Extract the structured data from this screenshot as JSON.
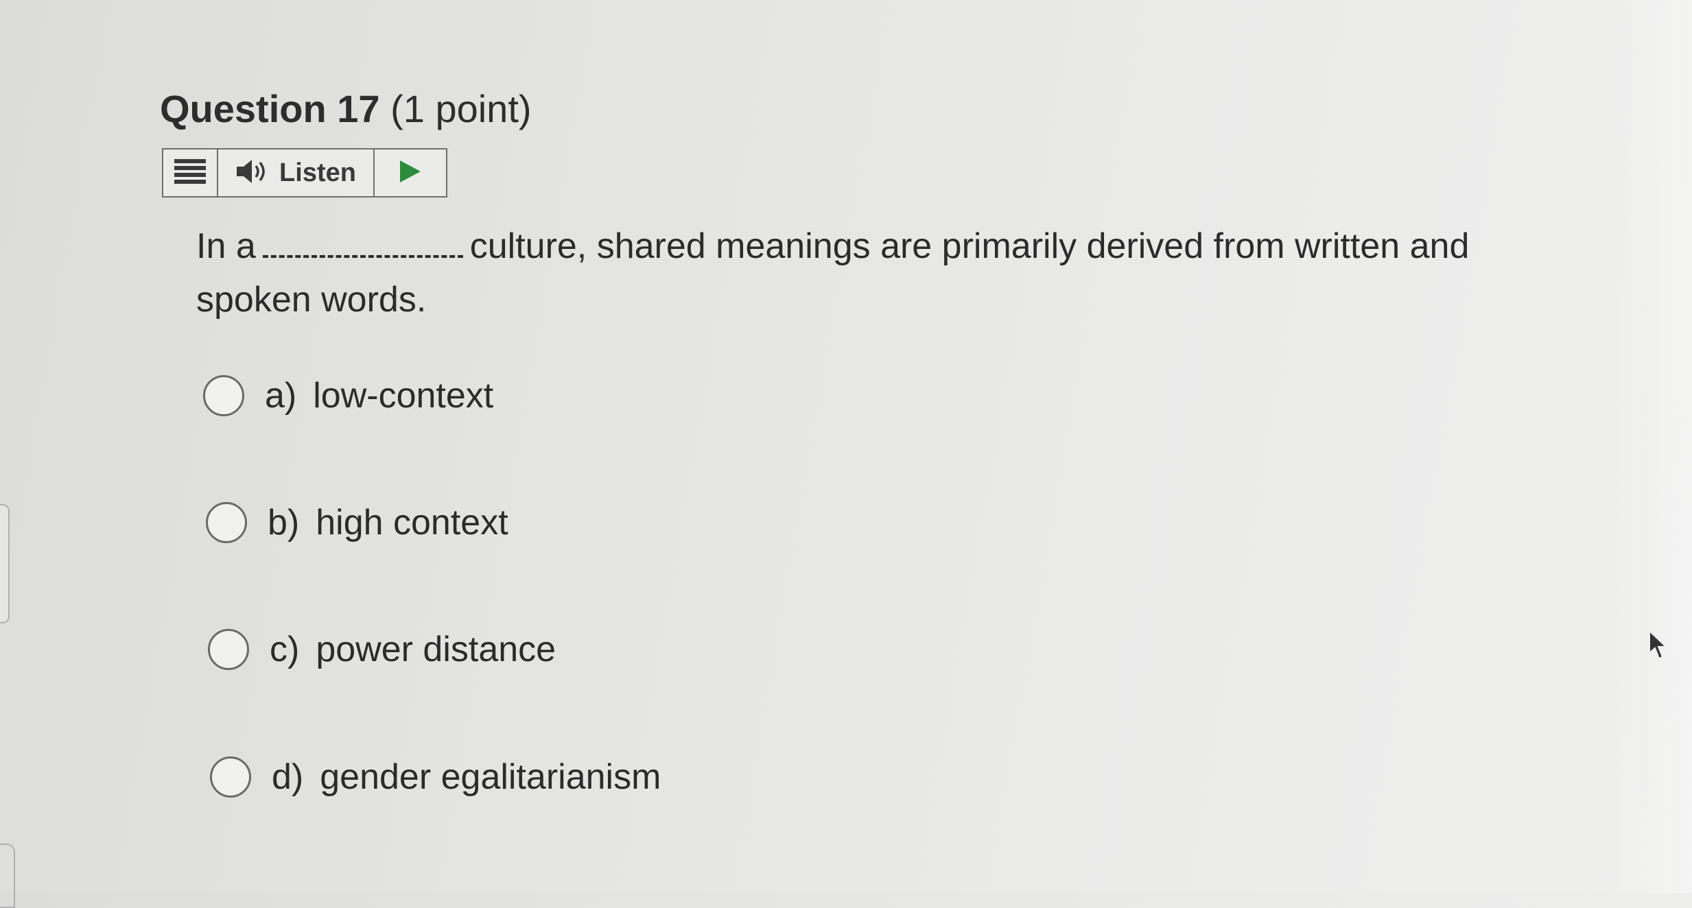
{
  "question": {
    "title": "Question 17",
    "points": "(1 point)"
  },
  "listen_bar": {
    "menu_icon": "menu-icon",
    "speaker_icon": "speaker-icon",
    "label": "Listen",
    "play_icon": "play-icon",
    "accent": "#2e8b3e"
  },
  "prompt": {
    "before_blank": "In a",
    "after_blank": "culture, shared meanings are primarily derived from written and spoken words."
  },
  "options": [
    {
      "letter": "a)",
      "text": "low-context",
      "selected": false
    },
    {
      "letter": "b)",
      "text": "high context",
      "selected": false
    },
    {
      "letter": "c)",
      "text": "power distance",
      "selected": false
    },
    {
      "letter": "d)",
      "text": "gender egalitarianism",
      "selected": false
    }
  ]
}
